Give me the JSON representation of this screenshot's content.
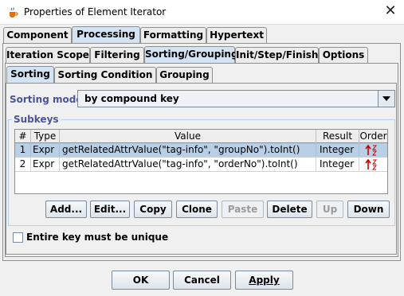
{
  "window": {
    "title": "Properties of Element Iterator",
    "close_icon": "close-icon",
    "app_icon": "java-cup-icon"
  },
  "tabs_level1": [
    "Component",
    "Processing",
    "Formatting",
    "Hypertext"
  ],
  "tabs_level1_selected": "Processing",
  "tabs_level2": [
    "Iteration Scope",
    "Filtering",
    "Sorting/Grouping",
    "Init/Step/Finish",
    "Options"
  ],
  "tabs_level2_selected": "Sorting/Grouping",
  "tabs_level3": [
    "Sorting",
    "Sorting Condition",
    "Grouping"
  ],
  "tabs_level3_selected": "Sorting",
  "sorting_mode": {
    "label": "Sorting mode:",
    "value": "by compound key"
  },
  "subkeys": {
    "legend": "Subkeys",
    "columns": [
      "#",
      "Type",
      "Value",
      "Result",
      "Order"
    ],
    "rows": [
      {
        "num": "1",
        "type": "Expr",
        "value": "getRelatedAttrValue(\"tag-info\", \"groupNo\").toInt()",
        "result": "Integer",
        "order_icon": "sort-ascending-icon",
        "selected": true
      },
      {
        "num": "2",
        "type": "Expr",
        "value": "getRelatedAttrValue(\"tag-info\", \"orderNo\").toInt()",
        "result": "Integer",
        "order_icon": "sort-ascending-icon",
        "selected": false
      }
    ],
    "buttons": {
      "add": "Add...",
      "edit": "Edit...",
      "copy": "Copy",
      "clone": "Clone",
      "paste": "Paste",
      "delete": "Delete",
      "up": "Up",
      "down": "Down"
    }
  },
  "unique_checkbox": {
    "label": "Entire key must be unique",
    "checked": false
  },
  "dialog_buttons": {
    "ok": "OK",
    "cancel": "Cancel",
    "apply": "Apply"
  },
  "colors": {
    "selected_tab": "#d3e3f3",
    "selected_row": "#b8cfe5",
    "label_blue": "#4a5599",
    "order_arrow": "#cc0000"
  }
}
